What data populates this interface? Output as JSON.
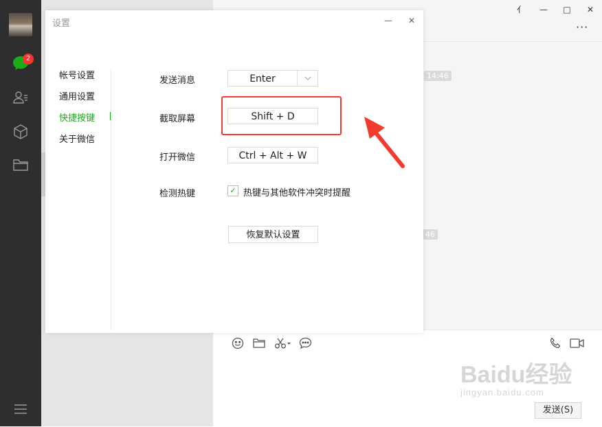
{
  "app": {
    "sidebar": {
      "badge_count": "2",
      "icons": [
        "chat-icon",
        "contacts-icon",
        "cube-icon",
        "folder-icon",
        "menu-icon"
      ]
    },
    "window_controls": {
      "pin": "⺅",
      "minimize": "—",
      "maximize": "□",
      "close": "✕"
    },
    "chat": {
      "more": "···",
      "time1": "14:46",
      "time2": "46",
      "send_label": "发送(S)"
    }
  },
  "dialog": {
    "title": "设置",
    "minimize": "—",
    "close": "✕",
    "nav": [
      {
        "label": "帐号设置"
      },
      {
        "label": "通用设置"
      },
      {
        "label": "快捷按键"
      },
      {
        "label": "关于微信"
      }
    ],
    "rows": {
      "send": {
        "label": "发送消息",
        "value": "Enter"
      },
      "screenshot": {
        "label": "截取屏幕",
        "value": "Shift + D"
      },
      "open": {
        "label": "打开微信",
        "value": "Ctrl + Alt + W"
      },
      "detect": {
        "label": "检测热键",
        "checkbox_label": "热键与其他软件冲突时提醒",
        "checked": true
      }
    },
    "reset_label": "恢复默认设置"
  },
  "watermark": {
    "line1": "Baidu经验",
    "line2": "jingyan.baidu.com"
  },
  "colors": {
    "accent_green": "#1aad19",
    "annotation_red": "#f23a2f",
    "badge_red": "#f43530",
    "sidebar_bg": "#2e2e2e"
  }
}
